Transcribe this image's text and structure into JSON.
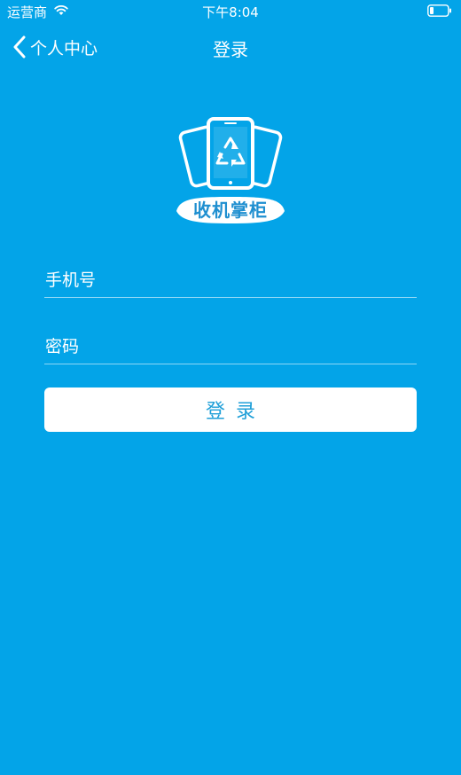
{
  "status_bar": {
    "carrier": "运营商",
    "time": "下午8:04"
  },
  "nav": {
    "back_label": "个人中心",
    "title": "登录"
  },
  "logo": {
    "text": "收机掌柜"
  },
  "form": {
    "phone_placeholder": "手机号",
    "phone_value": "",
    "password_placeholder": "密码",
    "password_value": "",
    "login_label": "登录"
  },
  "colors": {
    "background": "#03a4e8",
    "button_background": "#ffffff",
    "button_text": "#1f9fd8"
  },
  "icons": {
    "back": "chevron-left-icon",
    "wifi": "wifi-icon",
    "battery": "battery-icon",
    "logo": "phones-recycle-icon"
  }
}
